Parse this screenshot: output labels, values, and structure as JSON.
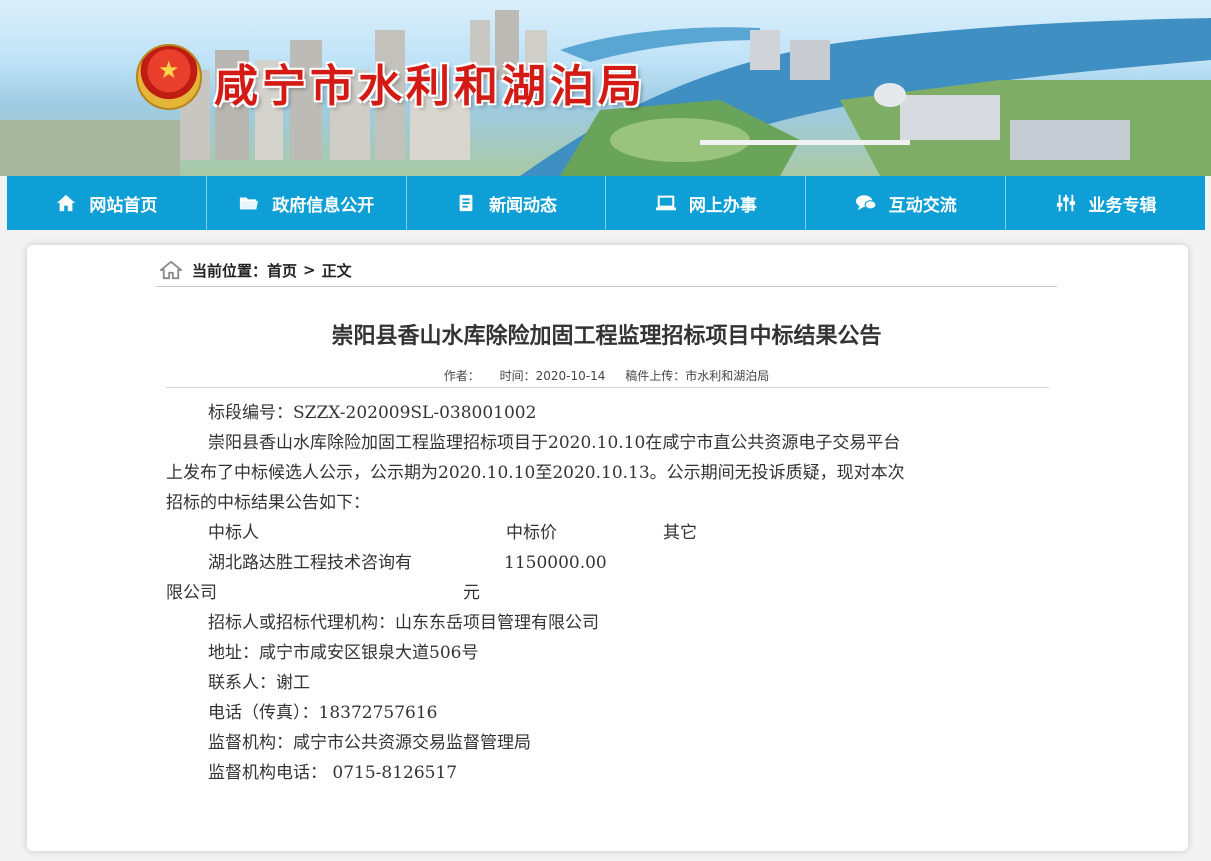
{
  "site": {
    "title": "咸宁市水利和湖泊局"
  },
  "nav": [
    {
      "label": "网站首页",
      "icon": "home-icon"
    },
    {
      "label": "政府信息公开",
      "icon": "folder-icon"
    },
    {
      "label": "新闻动态",
      "icon": "document-icon"
    },
    {
      "label": "网上办事",
      "icon": "laptop-icon"
    },
    {
      "label": "互动交流",
      "icon": "chat-icon"
    },
    {
      "label": "业务专辑",
      "icon": "sliders-icon"
    }
  ],
  "breadcrumb": {
    "prefix": "当前位置：",
    "home": "首页",
    "separator": ">",
    "current": "正文"
  },
  "article": {
    "title": "崇阳县香山水库除险加固工程监理招标项目中标结果公告",
    "meta": {
      "author": "作者：",
      "time": "时间：2020-10-14",
      "source": "稿件上传：市水利和湖泊局"
    },
    "paragraphs": {
      "section_no": "标段编号：SZZX-202009SL-038001002",
      "intro_line1": "崇阳县香山水库除险加固工程监理招标项目于2020.10.10在咸宁市直公共资源电子交易平台",
      "intro_line2": "上发布了中标候选人公示，公示期为2020.10.10至2020.10.13。公示期间无投诉质疑，现对本次",
      "intro_line3": "招标的中标结果公告如下：",
      "col_winner": "中标人",
      "col_price": "中标价",
      "col_other": "其它",
      "winner_line1": "湖北路达胜工程技术咨询有",
      "price_line1": "1150000.00",
      "winner_line2": "限公司",
      "price_line2": "元",
      "agency": "招标人或招标代理机构：山东东岳项目管理有限公司",
      "address": "地址：咸宁市咸安区银泉大道506号",
      "contact": "联系人：谢工",
      "phone": "电话（传真）：18372757616",
      "supervisor": "监督机构：咸宁市公共资源交易监督管理局",
      "supervisor_phone": "监督机构电话： 0715-8126517"
    }
  }
}
